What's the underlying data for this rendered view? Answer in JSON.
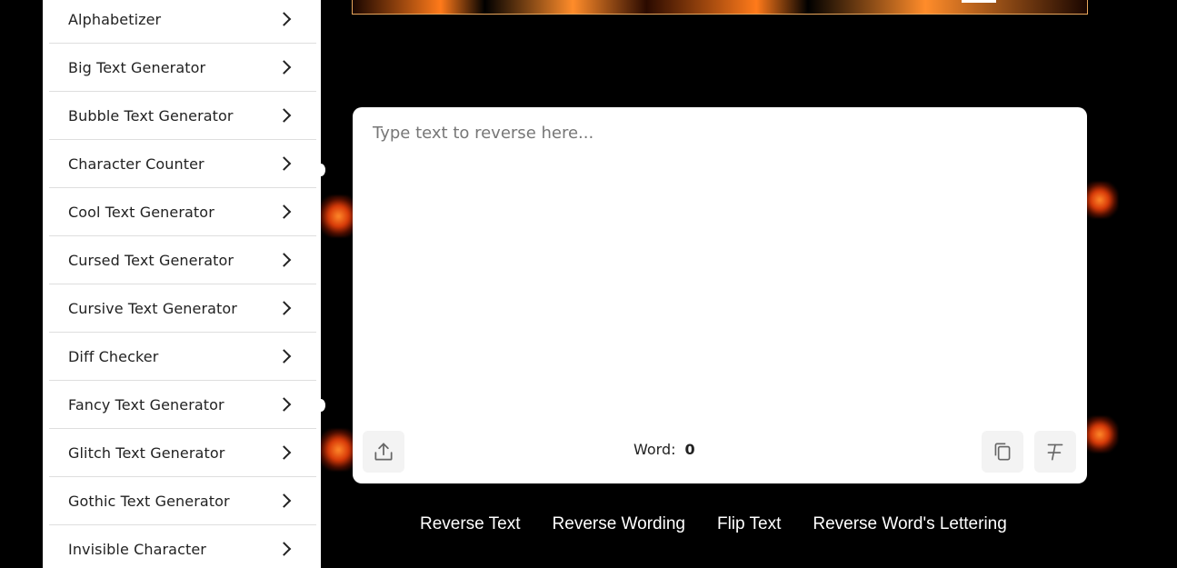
{
  "sidebar": {
    "items": [
      {
        "label": "Alphabetizer"
      },
      {
        "label": "Big Text Generator"
      },
      {
        "label": "Bubble Text Generator"
      },
      {
        "label": "Character Counter"
      },
      {
        "label": "Cool Text Generator"
      },
      {
        "label": "Cursed Text Generator"
      },
      {
        "label": "Cursive Text Generator"
      },
      {
        "label": "Diff Checker"
      },
      {
        "label": "Fancy Text Generator"
      },
      {
        "label": "Glitch Text Generator"
      },
      {
        "label": "Gothic Text Generator"
      },
      {
        "label": "Invisible Character"
      }
    ]
  },
  "editor": {
    "placeholder": "Type text to reverse here...",
    "value": "",
    "word_label": "Word:",
    "word_count": "0"
  },
  "icons": {
    "upload": "upload-icon",
    "copy": "copy-icon",
    "clear_format": "clear-format-icon"
  },
  "tabs": [
    {
      "label": "Reverse Text"
    },
    {
      "label": "Reverse Wording"
    },
    {
      "label": "Flip Text"
    },
    {
      "label": "Reverse Word's Lettering"
    }
  ],
  "colors": {
    "background": "#000000",
    "panel": "#ffffff",
    "accent_fire": "#ff7a1a"
  }
}
